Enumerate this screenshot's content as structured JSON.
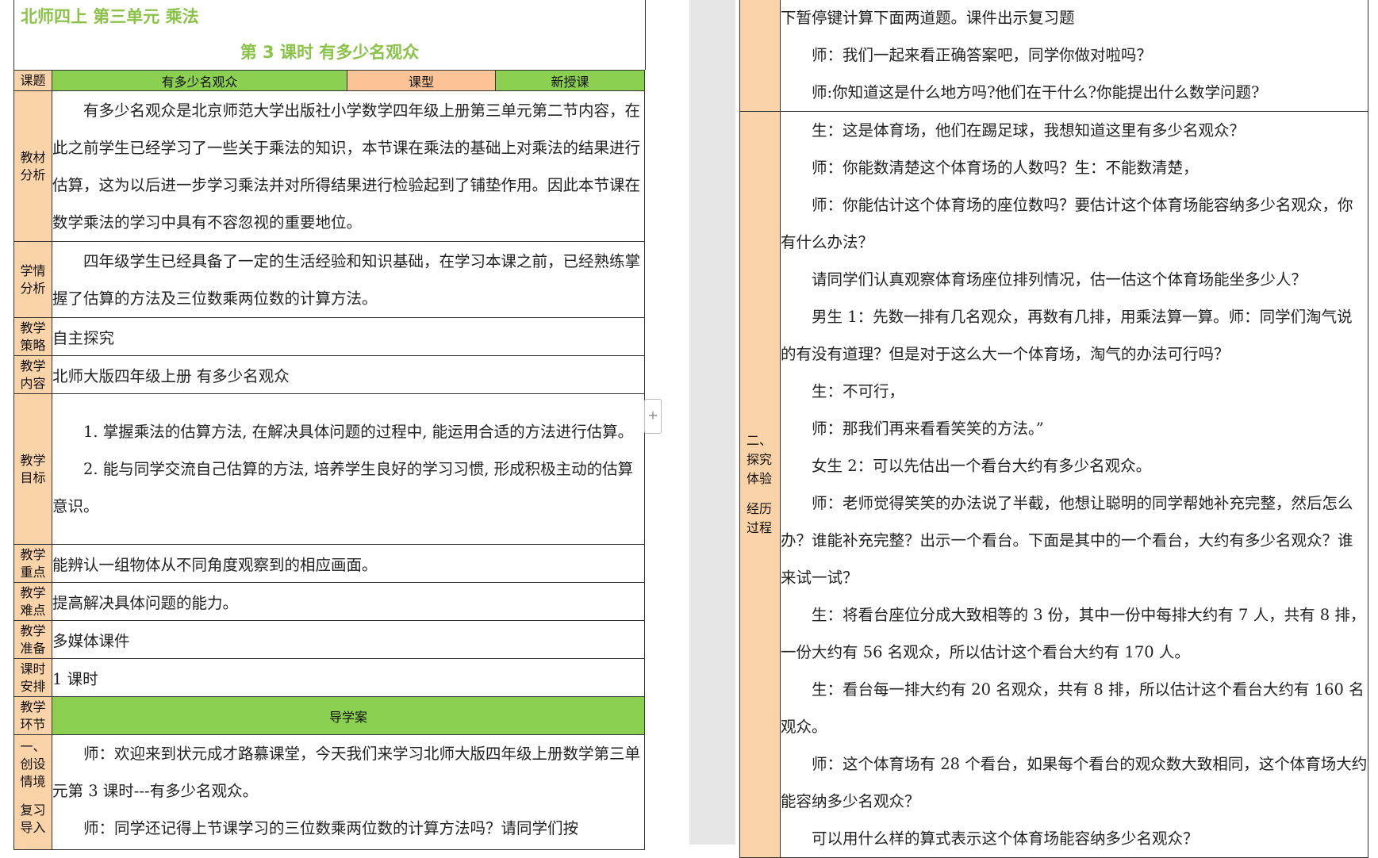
{
  "header": {
    "unit_title": "北师四上  第三单元  乘法",
    "lesson_title": "第 3 课时    有多少名观众"
  },
  "meta": {
    "topic_label": "课题",
    "topic_value": "有多少名观众",
    "type_label": "课型",
    "type_value": "新授课"
  },
  "rows": {
    "textbook": {
      "label": "教材分析",
      "text": "有多少名观众是北京师范大学出版社小学数学四年级上册第三单元第二节内容，在此之前学生已经学习了一些关于乘法的知识，本节课在乘法的基础上对乘法的结果进行估算，这为以后进一步学习乘法并对所得结果进行检验起到了铺垫作用。因此本节课在数学乘法的学习中具有不容忽视的重要地位。"
    },
    "students": {
      "label": "学情分析",
      "text": "四年级学生已经具备了一定的生活经验和知识基础，在学习本课之前，已经熟练掌握了估算的方法及三位数乘两位数的计算方法。"
    },
    "strategy": {
      "label": "教学策略",
      "text": "自主探究"
    },
    "content": {
      "label": "教学内容",
      "text": "北师大版四年级上册  有多少名观众"
    },
    "goals": {
      "label": "教学目标",
      "items": [
        "1. 掌握乘法的估算方法, 在解决具体问题的过程中, 能运用合适的方法进行估算。",
        "2. 能与同学交流自己估算的方法, 培养学生良好的学习习惯, 形成积极主动的估算意识。"
      ]
    },
    "key": {
      "label": "教学重点",
      "text": "能辨认一组物体从不同角度观察到的相应画面。"
    },
    "difficulty": {
      "label": "教学难点",
      "text": "提高解决具体问题的能力。"
    },
    "prep": {
      "label": "教学准备",
      "text": "多媒体课件"
    },
    "time": {
      "label": "课时安排",
      "text": "1 课时"
    },
    "section": {
      "label": "教学环节",
      "text": "导学案"
    },
    "intro": {
      "label": "一、创设情境",
      "label2": "复习导入",
      "paragraphs": [
        "师：欢迎来到状元成才路慕课堂，今天我们来学习北师大版四年级上册数学第三单元第 3 课时---有多少名观众。",
        "师：同学还记得上节课学习的三位数乘两位数的计算方法吗？请同学们按"
      ]
    }
  },
  "right": {
    "cont_paragraphs": [
      "下暂停键计算下面两道题。课件出示复习题",
      "师：我们一起来看正确答案吧，同学你做对啦吗？",
      "师:你知道这是什么地方吗?他们在干什么?你能提出什么数学问题?"
    ],
    "explore": {
      "label1": "二、探究体验",
      "label2": "经历过程",
      "paragraphs": [
        "生：这是体育场，他们在踢足球，我想知道这里有多少名观众？",
        "师：你能数清楚这个体育场的人数吗？生：不能数清楚，",
        "师：你能估计这个体育场的座位数吗？要估计这个体育场能容纳多少名观众，你有什么办法？",
        "请同学们认真观察体育场座位排列情况，估一估这个体育场能坐多少人？",
        "男生 1：先数一排有几名观众，再数有几排，用乘法算一算。师：同学们淘气说的有没有道理？但是对于这么大一个体育场，淘气的办法可行吗？",
        "生：不可行，",
        "师：那我们再来看看笑笑的方法。”",
        "女生 2：可以先估出一个看台大约有多少名观众。",
        "师：老师觉得笑笑的办法说了半截，他想让聪明的同学帮她补充完整，然后怎么办？谁能补充完整？出示一个看台。下面是其中的一个看台，大约有多少名观众？谁来试一试？",
        "生：将看台座位分成大致相等的 3 份，其中一份中每排大约有 7 人，共有 8 排，一份大约有 56 名观众，所以估计这个看台大约有 170 人。",
        "生：看台每一排大约有 20 名观众，共有 8 排，所以估计这个看台大约有 160 名观众。",
        "师：这个体育场有 28 个看台，如果每个看台的观众数大致相同，这个体育场大约能容纳多少名观众？",
        "可以用什么样的算式表示这个体育场能容纳多少名观众？"
      ]
    }
  },
  "colors": {
    "title_green": "#8bc34a",
    "label_bg": "#fbd3a8",
    "header_green": "#8bd050",
    "header_orange": "#fbc396"
  }
}
